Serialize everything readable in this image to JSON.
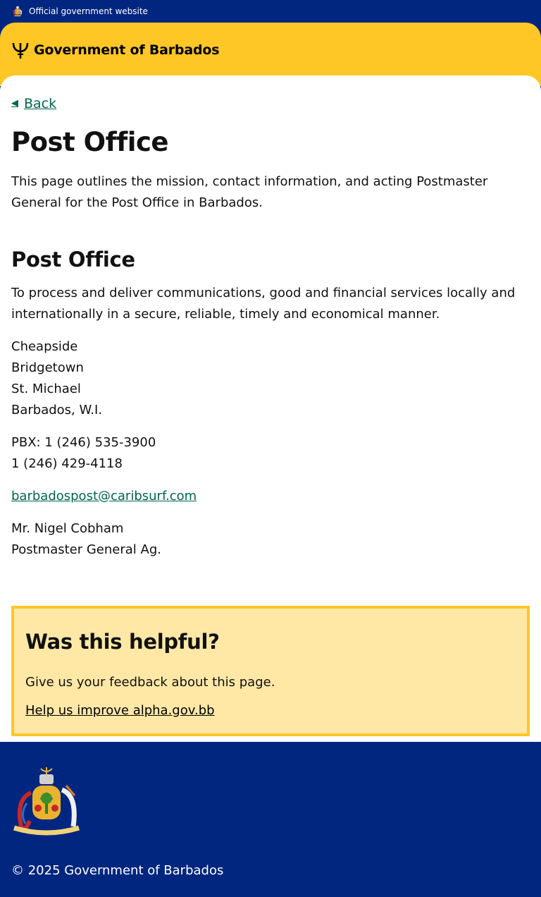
{
  "official_bar": {
    "text": "Official government website"
  },
  "header": {
    "brand": "Government of Barbados"
  },
  "nav": {
    "back_label": "Back"
  },
  "page": {
    "title": "Post Office",
    "intro": "This page outlines the mission, contact information, and acting Postmaster General for the Post Office in Barbados."
  },
  "section": {
    "title": "Post Office",
    "mission": "To process and deliver communications, good and financial services locally and internationally in a secure, reliable, timely and economical manner.",
    "address": [
      "Cheapside",
      "Bridgetown",
      "St. Michael",
      "Barbados, W.I."
    ],
    "phones": [
      "PBX: 1 (246) 535-3900",
      "1 (246) 429-4118"
    ],
    "email": "barbadospost@caribsurf.com",
    "contact_name": "Mr. Nigel Cobham",
    "contact_role": "Postmaster General Ag."
  },
  "feedback": {
    "title": "Was this helpful?",
    "text": "Give us your feedback about this page.",
    "link": "Help us improve alpha.gov.bb"
  },
  "footer": {
    "copyright": "© 2025 Government of Barbados"
  },
  "colors": {
    "navy": "#00267f",
    "gold": "#ffc726",
    "link_green": "#00654e",
    "feedback_bg": "#ffe8a6"
  },
  "icons": {
    "official": "coat-of-arms-icon",
    "brand": "trident-icon",
    "back": "arrow-left-icon"
  }
}
